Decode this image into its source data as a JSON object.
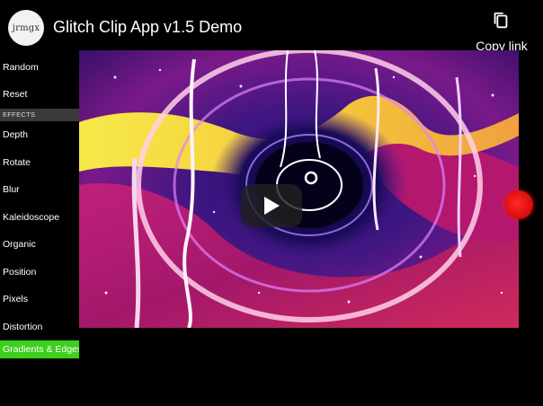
{
  "header": {
    "avatar_text": "jrmgx",
    "title": "Glitch Clip App v1.5 Demo",
    "copy_link_label": "Copy link",
    "copy_icon": "copy-icon"
  },
  "sidebar": {
    "top_items": [
      {
        "label": "Random"
      },
      {
        "label": "Reset"
      }
    ],
    "section_label": "EFFECTS",
    "effects": [
      {
        "label": "Depth"
      },
      {
        "label": "Rotate"
      },
      {
        "label": "Blur"
      },
      {
        "label": "Kaleidoscope"
      },
      {
        "label": "Organic"
      },
      {
        "label": "Position"
      },
      {
        "label": "Pixels"
      },
      {
        "label": "Distortion"
      },
      {
        "label": "Gradients & Edges",
        "active": true
      }
    ],
    "active_color": "#3ccf1d"
  },
  "video": {
    "play_icon": "play-icon",
    "record_icon": "record-icon",
    "record_color": "#e01010"
  }
}
